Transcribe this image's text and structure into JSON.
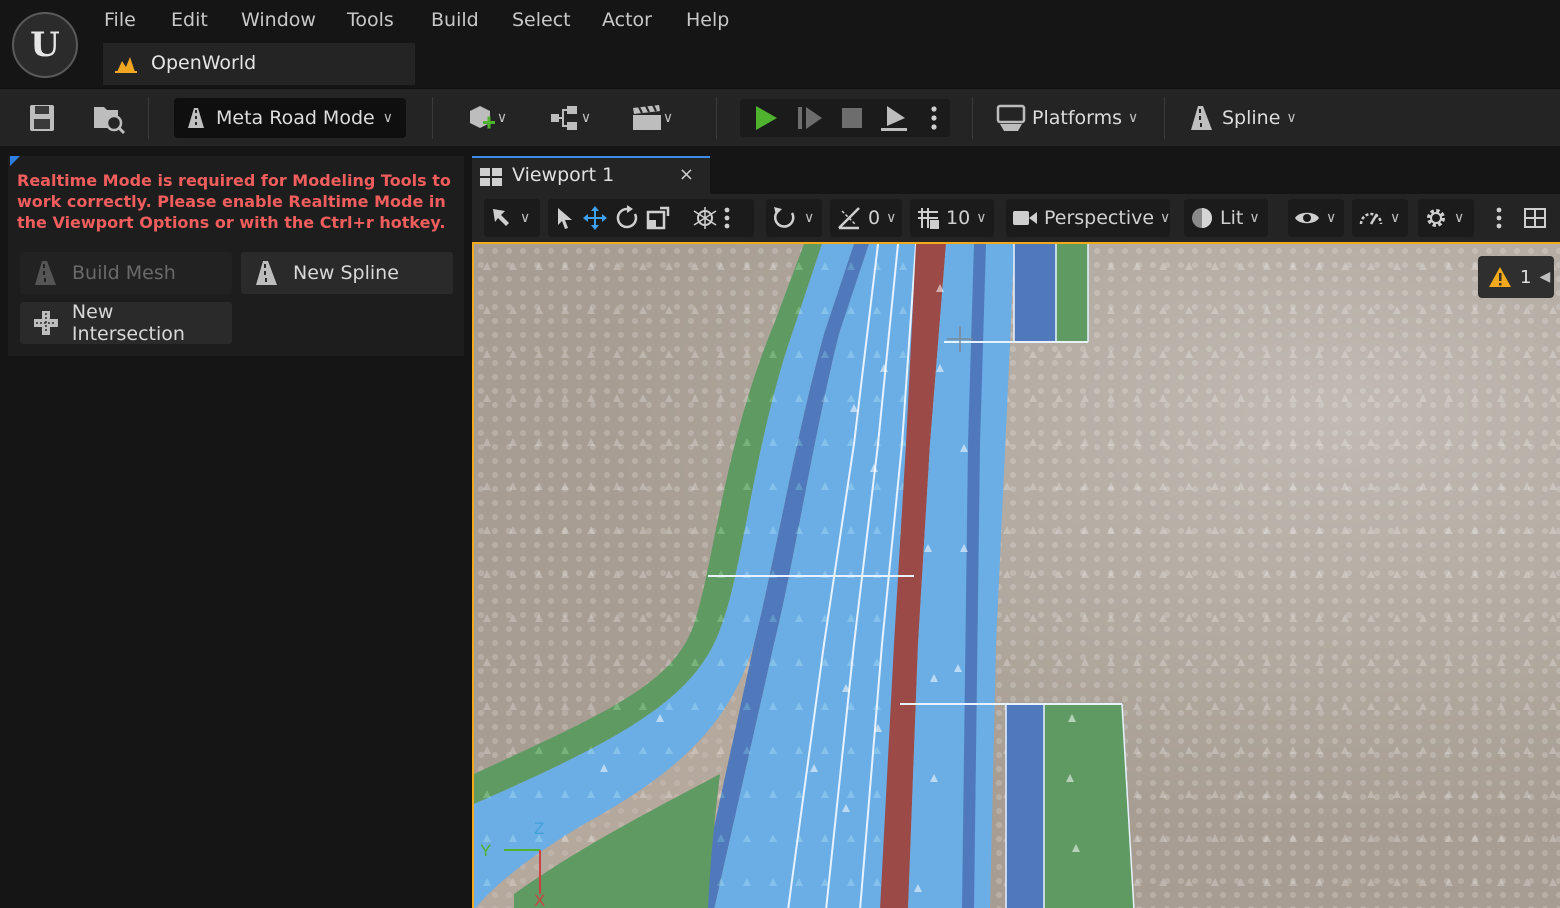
{
  "menu": {
    "items": [
      "File",
      "Edit",
      "Window",
      "Tools",
      "Build",
      "Select",
      "Actor",
      "Help"
    ]
  },
  "level": {
    "name": "OpenWorld"
  },
  "toolbar": {
    "mode_label": "Meta Road Mode",
    "platforms_label": "Platforms",
    "spline_label": "Spline"
  },
  "left_panel": {
    "warning": "Realtime Mode is required for Modeling Tools to work correctly. Please enable Realtime Mode in the Viewport Options or with the Ctrl+r hotkey.",
    "buttons": {
      "build_mesh": "Build Mesh",
      "new_spline": "New Spline",
      "new_intersection": "New Intersection"
    }
  },
  "viewport": {
    "tab_label": "Viewport 1",
    "tab_close": "×",
    "rotation_snap": "0",
    "grid_snap": "10",
    "view_mode": "Perspective",
    "lighting": "Lit",
    "warning_count": "1",
    "axes": {
      "x": "X",
      "y": "Y",
      "z": "Z"
    }
  },
  "colors": {
    "selection_border": "#f2a91b",
    "lane_blue": "#6aaee5",
    "lane_dark_blue": "#4f79bb",
    "lane_red": "#9b4a47",
    "lane_green": "#5f9a63",
    "warning_text": "#ef5d5d",
    "play_green": "#4fb32f"
  }
}
